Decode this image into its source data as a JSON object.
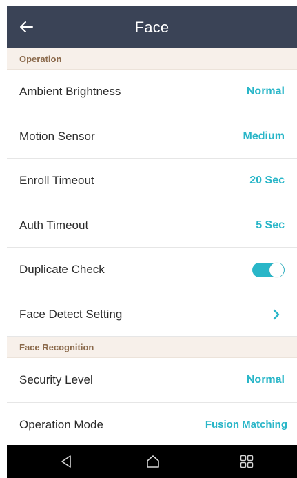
{
  "header": {
    "title": "Face",
    "back_icon": "arrow-left-icon"
  },
  "sections": {
    "operation": {
      "label": "Operation",
      "ambient_brightness": {
        "label": "Ambient Brightness",
        "value": "Normal"
      },
      "motion_sensor": {
        "label": "Motion Sensor",
        "value": "Medium"
      },
      "enroll_timeout": {
        "label": "Enroll Timeout",
        "value": "20 Sec"
      },
      "auth_timeout": {
        "label": "Auth Timeout",
        "value": "5 Sec"
      },
      "duplicate_check": {
        "label": "Duplicate Check",
        "enabled": true
      },
      "face_detect_setting": {
        "label": "Face Detect Setting",
        "icon": "chevron-right-icon"
      }
    },
    "face_recognition": {
      "label": "Face Recognition",
      "security_level": {
        "label": "Security Level",
        "value": "Normal"
      },
      "operation_mode": {
        "label": "Operation Mode",
        "value": "Fusion Matching"
      }
    }
  },
  "nav_bar": {
    "back_icon": "triangle-back-icon",
    "home_icon": "home-icon",
    "recents_icon": "recents-grid-icon"
  },
  "colors": {
    "header_bg": "#3a4356",
    "accent": "#29b6c8",
    "section_bg": "#f7f0ea",
    "section_text": "#8b6a4c",
    "nav_bg": "#000000"
  }
}
